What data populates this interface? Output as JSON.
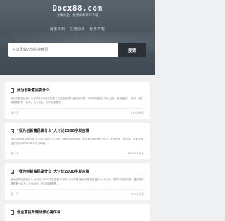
{
  "header": {
    "logo": "Docx88.com",
    "tagline": "文章大全、免费文章资料下载",
    "banner": "海量资料 · 在线阅读 · 免费下载"
  },
  "search": {
    "placeholder": "在这里输入你的搜索词",
    "button_label": "搜索"
  },
  "articles": [
    {
      "title": "我为创新富民做什么",
      "desc": "我为创新富民做什么 去年11月召开的第十三次全省党代会报告中第一次鲜明地提出\"努力创新，聚焦富民\"，创新、是引领发展的第一动力，大众创业，万众创新更是…",
      "author": "搜一下",
      "reads": "753人阅读"
    },
    {
      "title": "\"我为创新富民做什么\"大讨论2500字发言稿",
      "desc": "\"我为创新富民做什么\"大讨论2500字发言稿，服务中国的创新，是引领发展的第一动力，大众创业、鼓劲者、以新发展理念引领1040148 2.5 万读者…",
      "author": "搜一下",
      "reads": "16063人阅读"
    },
    {
      "title": "\"我为创新富民做什么\"大讨论2000字发言稿",
      "desc": "我为创新富民做什么 大讨论 2000字发言稿 下午好 今天开展\"我为创新富民做什么\"大讨论，服务中国的创新，是引领发展的第一动力，大众创业、万众创新更是…",
      "author": "搜一下",
      "reads": "573人阅读"
    },
    {
      "title": "创业富民专题研修心得体会"
    }
  ]
}
